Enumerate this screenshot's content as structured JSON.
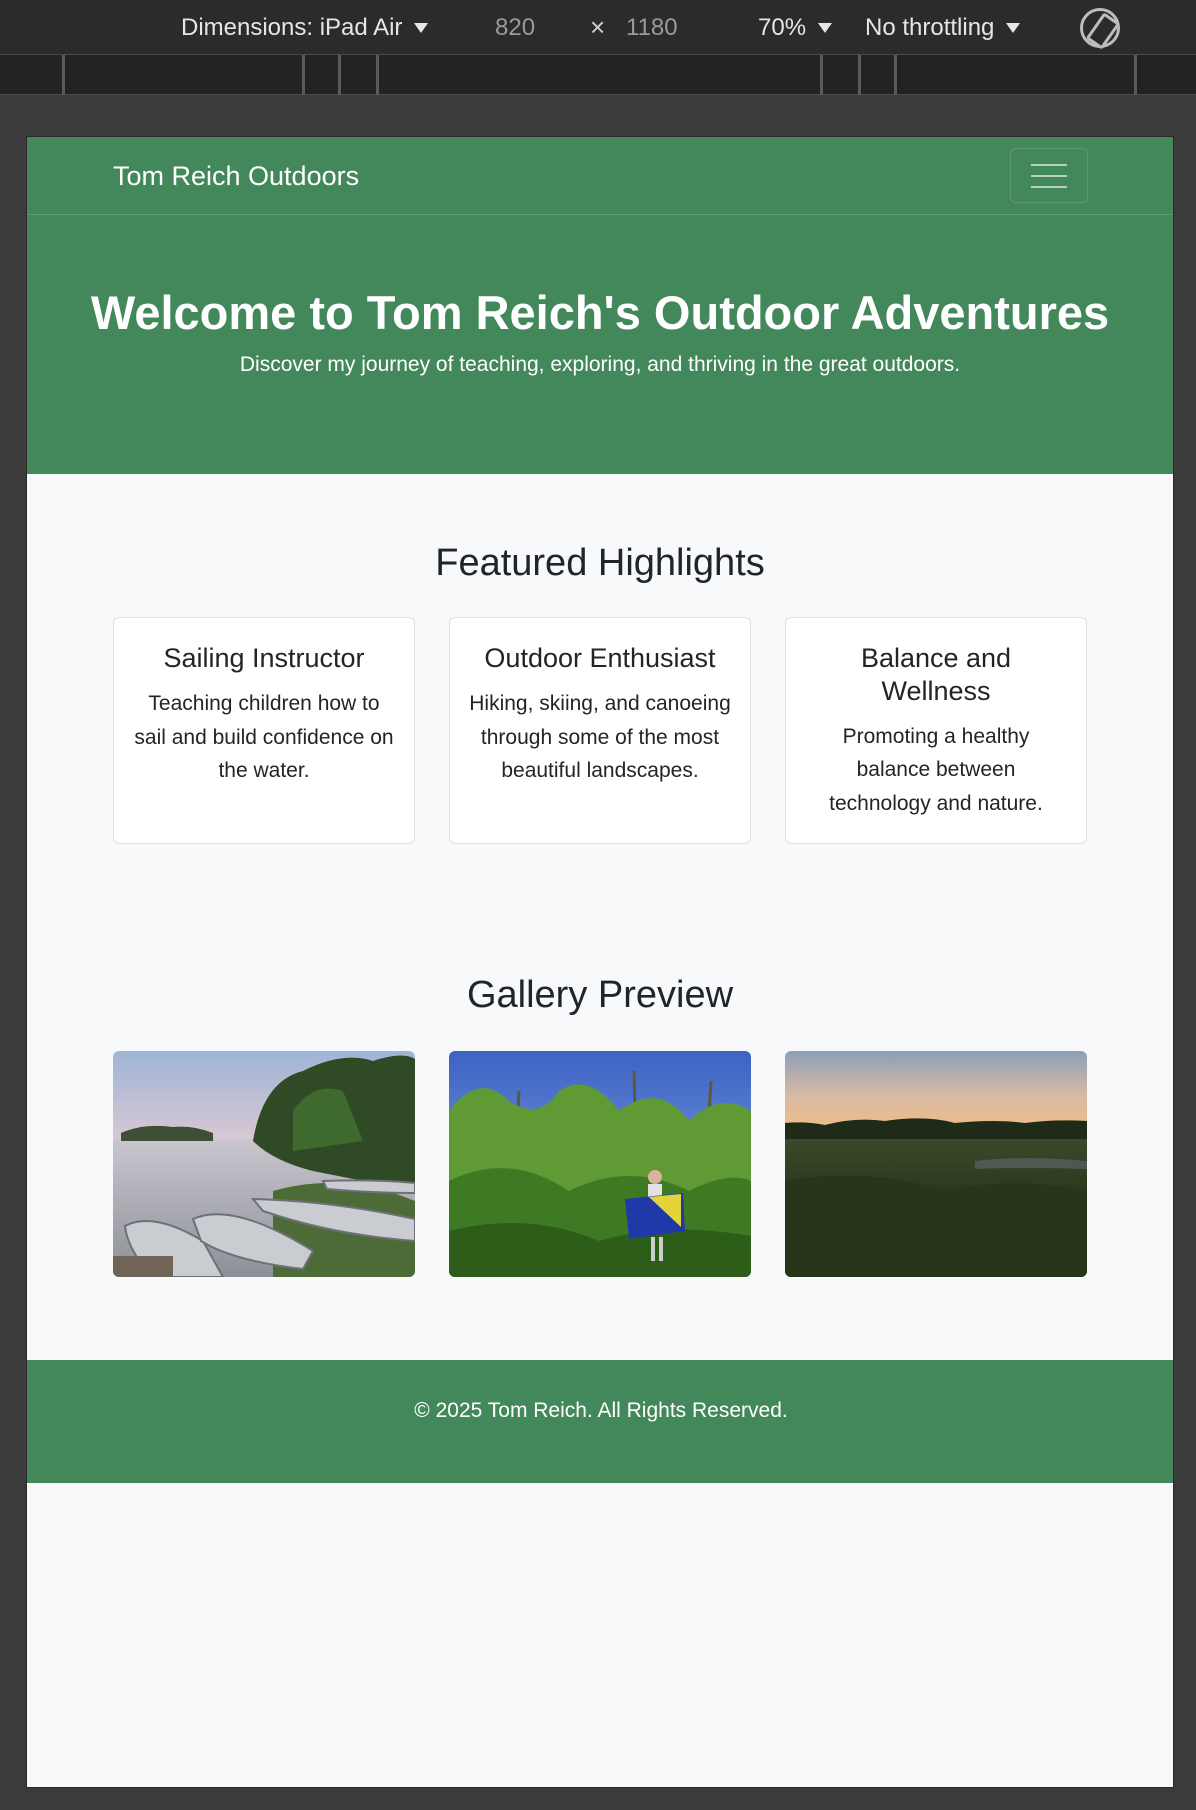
{
  "devtools": {
    "dimensions_label": "Dimensions: iPad Air",
    "width": "820",
    "times": "×",
    "height": "1180",
    "zoom": "70%",
    "throttling": "No throttling"
  },
  "navbar": {
    "brand": "Tom Reich Outdoors"
  },
  "hero": {
    "title": "Welcome to Tom Reich's Outdoor Adventures",
    "subtitle": "Discover my journey of teaching, exploring, and thriving in the great outdoors."
  },
  "featured": {
    "title": "Featured Highlights",
    "cards": [
      {
        "title": "Sailing Instructor",
        "text": "Teaching children how to sail and build confidence on the water."
      },
      {
        "title": "Outdoor Enthusiast",
        "text": "Hiking, skiing, and canoeing through some of the most beautiful landscapes."
      },
      {
        "title": "Balance and Wellness",
        "text": "Promoting a healthy balance between technology and nature."
      }
    ]
  },
  "gallery": {
    "title": "Gallery Preview"
  },
  "footer": {
    "text": "© 2025 Tom Reich. All Rights Reserved."
  },
  "colors": {
    "brand_green": "#43885b",
    "page_bg": "#f8f9fa"
  }
}
